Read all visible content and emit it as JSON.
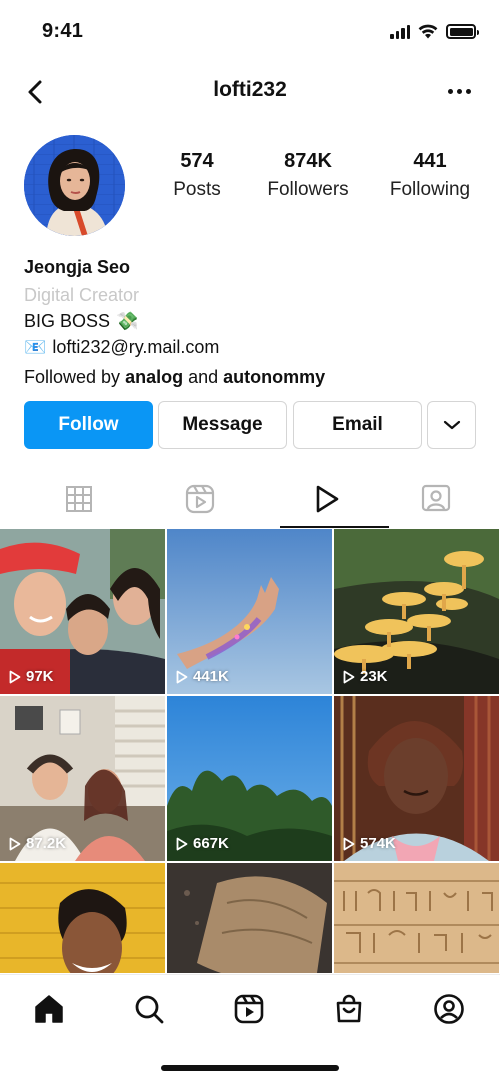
{
  "status_bar": {
    "time": "9:41"
  },
  "header": {
    "username": "lofti232"
  },
  "stats": [
    {
      "value": "574",
      "label": "Posts"
    },
    {
      "value": "874K",
      "label": "Followers"
    },
    {
      "value": "441",
      "label": "Following"
    }
  ],
  "bio": {
    "name": "Jeongja Seo",
    "category": "Digital Creator",
    "line1": "BIG BOSS",
    "line1_emoji": "💸",
    "email_emoji": "📧",
    "email": "lofti232@ry.mail.com",
    "followed_prefix": "Followed by",
    "followed_user1": "analog",
    "followed_and": "and",
    "followed_user2": "autonommy"
  },
  "buttons": {
    "follow": "Follow",
    "message": "Message",
    "email": "Email"
  },
  "tabs": [
    "grid-icon",
    "reels-icon",
    "play-icon",
    "tagged-icon"
  ],
  "active_tab": "play-icon",
  "grid_items": [
    {
      "views": "97K"
    },
    {
      "views": "441K"
    },
    {
      "views": "23K"
    },
    {
      "views": "87.2K"
    },
    {
      "views": "667K"
    },
    {
      "views": "574K"
    },
    {
      "views": ""
    },
    {
      "views": ""
    },
    {
      "views": ""
    }
  ],
  "bottom_nav": [
    "home-icon",
    "search-icon",
    "reels-icon",
    "shop-icon",
    "profile-icon"
  ],
  "colors": {
    "accent": "#0a96f5",
    "muted": "#c8c8c8"
  }
}
